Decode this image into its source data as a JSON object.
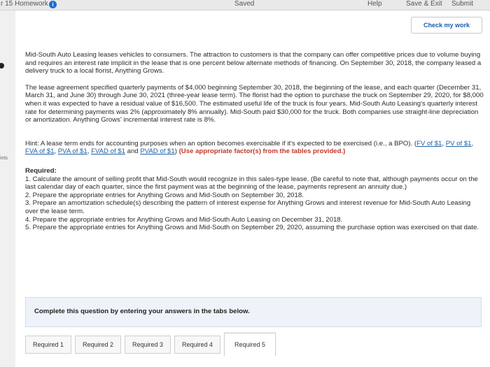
{
  "topbar": {
    "title": "r 15 Homework",
    "info_glyph": "i",
    "saved": "Saved",
    "help": "Help",
    "save_exit": "Save & Exit",
    "submit": "Submit"
  },
  "check_my_work": "Check my work",
  "gutter_points": "ints",
  "problem": {
    "intro": "Mid-South Auto Leasing leases vehicles to consumers. The attraction to customers is that the company can offer competitive prices due to volume buying and requires an interest rate implicit in the lease that is one percent below alternate methods of financing. On September 30, 2018, the company leased a delivery truck to a local florist, Anything Grows.",
    "agreement": "The lease agreement specified quarterly payments of $4,000 beginning September 30, 2018, the beginning of the lease, and each quarter (December 31, March 31, and June 30) through June 30, 2021 (three-year lease term). The florist had the option to purchase the truck on September 29, 2020, for $8,000 when it was expected to have a residual value of $16,500. The estimated useful life of the truck is four years. Mid-South Auto Leasing's quarterly interest rate for determining payments was 2% (approximately 8% annually). Mid-South paid $30,000 for the truck. Both companies use straight-line depreciation or amortization. Anything Grows' incremental interest rate is 8%.",
    "hint_prefix": "Hint: A lease term ends for accounting purposes when an option becomes exercisable if it's expected to be exercised (i.e., a BPO). (",
    "links": [
      "FV of $1",
      "PV of $1",
      "FVA of $1",
      "PVA of $1",
      "FVAD of $1",
      "PVAD of $1"
    ],
    "link_sep": ", ",
    "link_and": " and ",
    "hint_close": ") ",
    "hint_emph": "(Use appropriate factor(s) from the tables provided.)",
    "required_heading": "Required:",
    "required_items": [
      "1. Calculate the amount of selling profit that Mid-South would recognize in this sales-type lease. (Be careful to note that, although payments occur on the last calendar day of each quarter, since the first payment was at the beginning of the lease, payments represent an annuity due.)",
      "2. Prepare the appropriate entries for Anything Grows and Mid-South on September 30, 2018.",
      "3. Prepare an amortization schedule(s) describing the pattern of interest expense for Anything Grows and interest revenue for Mid-South Auto Leasing over the lease term.",
      "4. Prepare the appropriate entries for Anything Grows and Mid-South Auto Leasing on December 31, 2018.",
      "5. Prepare the appropriate entries for Anything Grows and Mid-South on September 29, 2020, assuming the purchase option was exercised on that date."
    ]
  },
  "instructions": "Complete this question by entering your answers in the tabs below.",
  "tabs": [
    "Required 1",
    "Required 2",
    "Required 3",
    "Required 4",
    "Required 5"
  ],
  "active_tab": "Required 5"
}
